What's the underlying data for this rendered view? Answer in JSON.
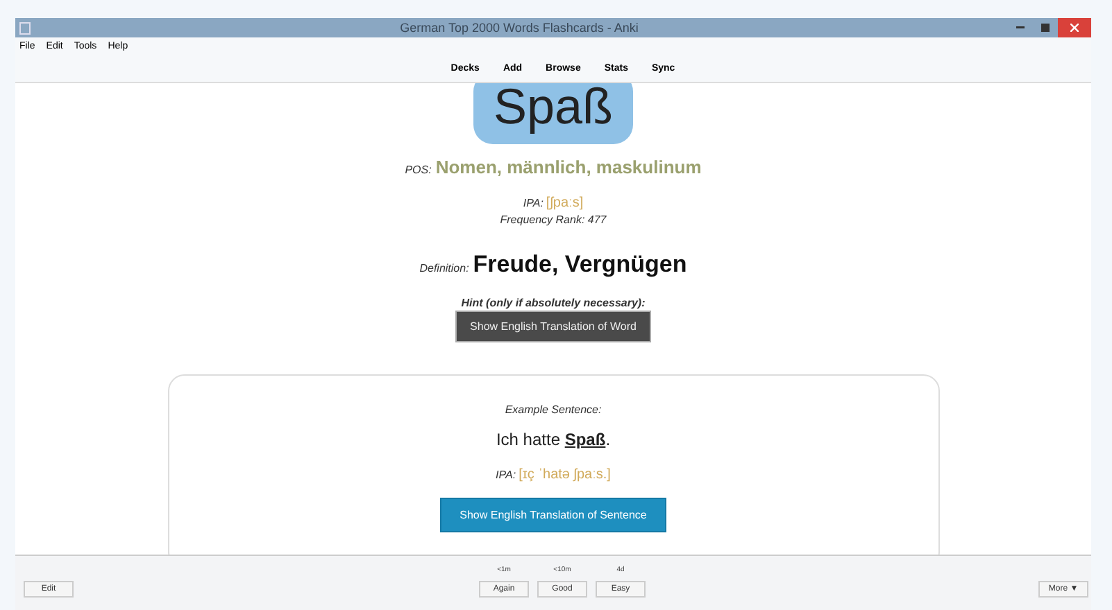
{
  "window": {
    "title": "German Top 2000 Words Flashcards - Anki"
  },
  "menu": [
    "File",
    "Edit",
    "Tools",
    "Help"
  ],
  "toolbar": [
    "Decks",
    "Add",
    "Browse",
    "Stats",
    "Sync"
  ],
  "card": {
    "word": "Spaß",
    "pos_label": "POS:",
    "pos": "Nomen, männlich, maskulinum",
    "ipa_label": "IPA:",
    "ipa": "[ʃpaːs]",
    "frequency": "Frequency Rank: 477",
    "definition_label": "Definition:",
    "definition": "Freude, Vergnügen",
    "hint": "Hint (only if absolutely necessary):",
    "word_button": "Show English Translation of Word",
    "example_label": "Example Sentence:",
    "sentence": "Ich hatte **Spaß**.",
    "sentence_ipa_label": "IPA:",
    "sentence_ipa": "[ɪç ˈhatə ʃpaːs.]",
    "sentence_button": "Show English Translation of Sentence"
  },
  "bottom": {
    "edit": "Edit",
    "answers": [
      {
        "interval": "<1m",
        "label": "Again"
      },
      {
        "interval": "<10m",
        "label": "Good"
      },
      {
        "interval": "4d",
        "label": "Easy"
      }
    ],
    "more": "More ▼"
  }
}
